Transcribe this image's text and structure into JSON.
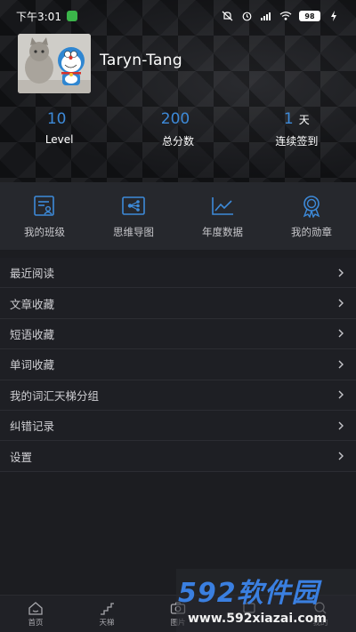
{
  "status_bar": {
    "time": "下午3:01",
    "battery": "98"
  },
  "profile": {
    "username": "Taryn-Tang"
  },
  "stats": [
    {
      "value": "10",
      "unit": "",
      "label": "Level"
    },
    {
      "value": "200",
      "unit": "",
      "label": "总分数"
    },
    {
      "value": "1",
      "unit": "天",
      "label": "连续签到"
    }
  ],
  "actions": [
    {
      "label": "我的班级",
      "icon": "class-icon"
    },
    {
      "label": "思维导图",
      "icon": "mindmap-icon"
    },
    {
      "label": "年度数据",
      "icon": "chart-icon"
    },
    {
      "label": "我的勋章",
      "icon": "medal-icon"
    }
  ],
  "menu": [
    {
      "label": "最近阅读"
    },
    {
      "label": "文章收藏"
    },
    {
      "label": "短语收藏"
    },
    {
      "label": "单词收藏"
    },
    {
      "label": "我的词汇天梯分组"
    },
    {
      "label": "纠错记录"
    },
    {
      "label": "设置"
    }
  ],
  "tabs": [
    {
      "label": "首页",
      "icon": "home-icon"
    },
    {
      "label": "天梯",
      "icon": "ladder-icon"
    },
    {
      "label": "图片",
      "icon": "camera-icon"
    },
    {
      "label": "",
      "icon": "hidden-tab-icon"
    },
    {
      "label": "我的",
      "icon": "search-icon"
    }
  ],
  "watermark": {
    "brand": "592软件园",
    "url": "www.592xiazai.com"
  },
  "colors": {
    "accent": "#3d8ad9",
    "background": "#1c1d21"
  }
}
